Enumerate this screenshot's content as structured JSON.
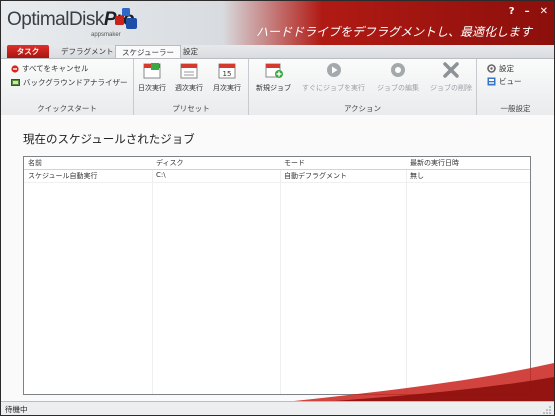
{
  "app": {
    "logo_main": "OptimalDisk",
    "logo_pro": "Pro",
    "logo_sub": "appsmaker",
    "tagline": "ハードドライブをデフラグメントし、最適化します",
    "window_controls": [
      "?",
      "–",
      "✕"
    ]
  },
  "tabs": [
    {
      "label": "タスク",
      "active": false
    },
    {
      "label": "デフラグメント",
      "active": false
    },
    {
      "label": "スケジューラー",
      "active": true
    },
    {
      "label": "設定",
      "active": false
    }
  ],
  "ribbon": {
    "quick_start": {
      "label": "クイックスタート",
      "items": [
        {
          "label": "すべてをキャンセル",
          "icon": "cancel-icon"
        },
        {
          "label": "バックグラウンドアナライザー",
          "icon": "analyzer-icon"
        }
      ]
    },
    "preset": {
      "label": "プリセット",
      "buttons": [
        {
          "label": "日次実行",
          "icon": "calendar-daily-icon",
          "badge": "1"
        },
        {
          "label": "週次実行",
          "icon": "calendar-weekly-icon",
          "badge": ""
        },
        {
          "label": "月次実行",
          "icon": "calendar-monthly-icon",
          "badge": "15"
        }
      ]
    },
    "action": {
      "label": "アクション",
      "buttons": [
        {
          "label": "新規ジョブ",
          "icon": "new-job-icon",
          "enabled": true
        },
        {
          "label": "すぐにジョブを実行",
          "icon": "run-now-icon",
          "enabled": false
        },
        {
          "label": "ジョブの編集",
          "icon": "edit-job-icon",
          "enabled": false
        },
        {
          "label": "ジョブの削除",
          "icon": "delete-job-icon",
          "enabled": false
        }
      ]
    },
    "general": {
      "label": "一般設定",
      "items": [
        {
          "label": "設定",
          "icon": "settings-icon"
        },
        {
          "label": "ビュー",
          "icon": "view-icon"
        }
      ]
    }
  },
  "main": {
    "heading": "現在のスケジュールされたジョブ",
    "columns": [
      "名前",
      "ディスク",
      "モード",
      "最新の実行日時"
    ],
    "rows": [
      [
        "スケジュール自動実行",
        "C:\\",
        "自動デフラグメント",
        "無し"
      ]
    ]
  },
  "status": {
    "text": "待機中"
  },
  "colors": {
    "accent": "#b11a14",
    "tab_active": "#c8221c"
  }
}
